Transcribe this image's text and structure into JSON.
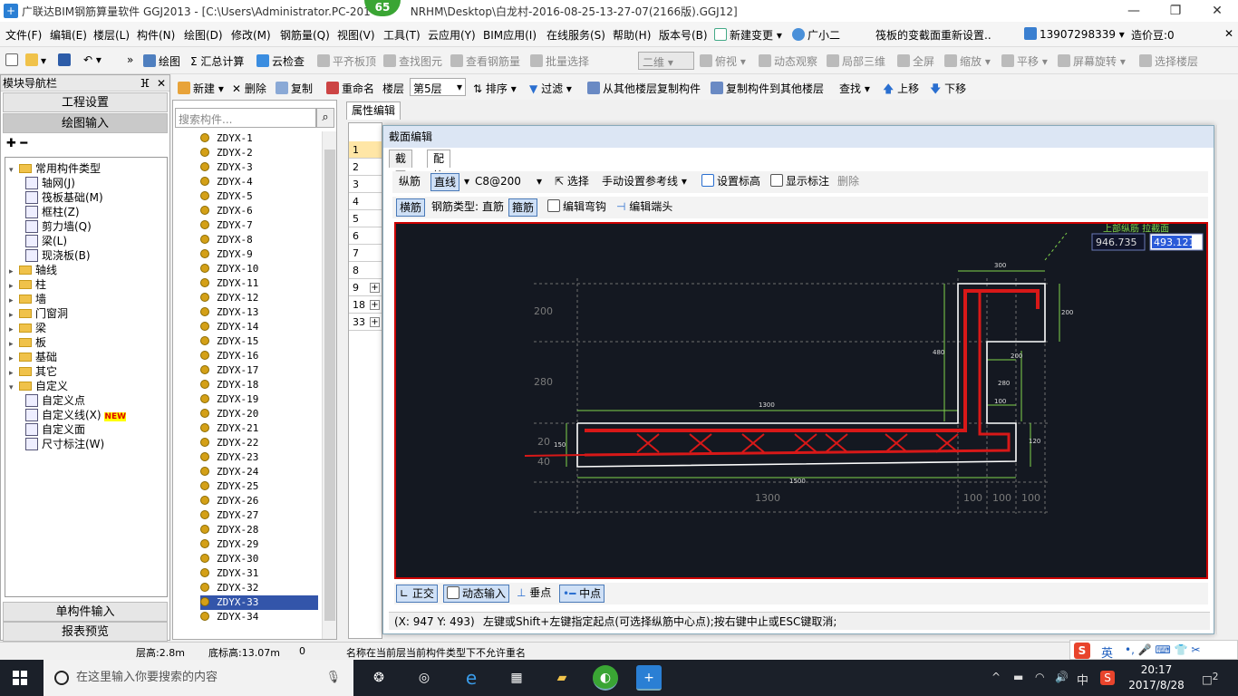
{
  "window": {
    "title": "广联达BIM钢筋算量软件 GGJ2013 - [C:\\Users\\Administrator.PC-201",
    "title_tail": "NRHM\\Desktop\\白龙村-2016-08-25-13-27-07(2166版).GGJ12]",
    "badge": "65",
    "min": "—",
    "max": "❐",
    "close": "✕"
  },
  "menu": {
    "items": [
      "文件(F)",
      "编辑(E)",
      "楼层(L)",
      "构件(N)",
      "绘图(D)",
      "修改(M)",
      "钢筋量(Q)",
      "视图(V)",
      "工具(T)",
      "云应用(Y)",
      "BIM应用(I)",
      "在线服务(S)",
      "帮助(H)",
      "版本号(B)",
      "新建变更 ▾",
      "广小二"
    ],
    "notice": "筏板的变截面重新设置..",
    "phone": "13907298339 ▾",
    "price": "造价豆:0",
    "close": "✕"
  },
  "toolbar1": {
    "items": [
      "绘图",
      "Σ 汇总计算",
      "云检查",
      "平齐板顶",
      "查找图元",
      "查看钢筋量",
      "批量选择",
      "二维",
      "俯视 ▾",
      "动态观察",
      "局部三维",
      "全屏",
      "缩放 ▾",
      "平移 ▾",
      "屏幕旋转 ▾",
      "选择楼层"
    ]
  },
  "toolbar2": {
    "items": [
      "新建 ▾",
      "删除",
      "复制",
      "重命名",
      "楼层",
      "第5层",
      "排序 ▾",
      "过滤 ▾",
      "从其他楼层复制构件",
      "复制构件到其他楼层",
      "查找 ▾",
      "上移",
      "下移"
    ]
  },
  "left_panel": {
    "title": "模块导航栏",
    "pin": "ⴼ",
    "close": "✕",
    "btn_project": "工程设置",
    "btn_draw": "绘图输入",
    "btn_single": "单构件输入",
    "btn_report": "报表预览",
    "tree": [
      {
        "label": "常用构件类型",
        "level": 0,
        "type": "folder",
        "exp": "▾"
      },
      {
        "label": "轴网(J)",
        "level": 1,
        "type": "leaf"
      },
      {
        "label": "筏板基础(M)",
        "level": 1,
        "type": "leaf"
      },
      {
        "label": "框柱(Z)",
        "level": 1,
        "type": "leaf"
      },
      {
        "label": "剪力墙(Q)",
        "level": 1,
        "type": "leaf"
      },
      {
        "label": "梁(L)",
        "level": 1,
        "type": "leaf"
      },
      {
        "label": "现浇板(B)",
        "level": 1,
        "type": "leaf"
      },
      {
        "label": "轴线",
        "level": 0,
        "type": "folder",
        "exp": "▸"
      },
      {
        "label": "柱",
        "level": 0,
        "type": "folder",
        "exp": "▸"
      },
      {
        "label": "墙",
        "level": 0,
        "type": "folder",
        "exp": "▸"
      },
      {
        "label": "门窗洞",
        "level": 0,
        "type": "folder",
        "exp": "▸"
      },
      {
        "label": "梁",
        "level": 0,
        "type": "folder",
        "exp": "▸"
      },
      {
        "label": "板",
        "level": 0,
        "type": "folder",
        "exp": "▸"
      },
      {
        "label": "基础",
        "level": 0,
        "type": "folder",
        "exp": "▸"
      },
      {
        "label": "其它",
        "level": 0,
        "type": "folder",
        "exp": "▸"
      },
      {
        "label": "自定义",
        "level": 0,
        "type": "folder",
        "exp": "▾"
      },
      {
        "label": "自定义点",
        "level": 1,
        "type": "leaf"
      },
      {
        "label": "自定义线(X)",
        "level": 1,
        "type": "leaf",
        "new": "NEW"
      },
      {
        "label": "自定义面",
        "level": 1,
        "type": "leaf"
      },
      {
        "label": "尺寸标注(W)",
        "level": 1,
        "type": "leaf"
      }
    ]
  },
  "component_list": {
    "search_placeholder": "搜索构件...",
    "search_icon": "⌕",
    "items": [
      "ZDYX-1",
      "ZDYX-2",
      "ZDYX-3",
      "ZDYX-4",
      "ZDYX-5",
      "ZDYX-6",
      "ZDYX-7",
      "ZDYX-8",
      "ZDYX-9",
      "ZDYX-10",
      "ZDYX-11",
      "ZDYX-12",
      "ZDYX-13",
      "ZDYX-14",
      "ZDYX-15",
      "ZDYX-16",
      "ZDYX-17",
      "ZDYX-18",
      "ZDYX-19",
      "ZDYX-20",
      "ZDYX-21",
      "ZDYX-22",
      "ZDYX-23",
      "ZDYX-24",
      "ZDYX-25",
      "ZDYX-26",
      "ZDYX-27",
      "ZDYX-28",
      "ZDYX-29",
      "ZDYX-30",
      "ZDYX-31",
      "ZDYX-32",
      "ZDYX-33",
      "ZDYX-34"
    ],
    "selected": "ZDYX-33"
  },
  "property": {
    "tab": "属性编辑",
    "rows": [
      "1",
      "2",
      "3",
      "4",
      "5",
      "6",
      "7",
      "8",
      "9",
      "18",
      "33"
    ],
    "expandable_plus": "+"
  },
  "dialog": {
    "title": "截面编辑",
    "tabs": [
      "截面",
      "配筋"
    ],
    "active_tab": "配筋",
    "toolbar1": {
      "longitudinal": "纵筋",
      "line": "直线",
      "spec": "C8@200",
      "select": "选择",
      "manual": "手动设置参考线",
      "set_elev": "设置标高",
      "show_dim": "显示标注",
      "delete": "删除"
    },
    "toolbar2": {
      "transverse": "横筋",
      "rebar_type_label": "钢筋类型:",
      "straight": "直筋",
      "stirrup": "箍筋",
      "edit_hook": "编辑弯钩",
      "edit_end": "编辑端头"
    },
    "coord_x": "946.735",
    "coord_y": "493.121",
    "label_top": "上部纵筋 拉截面",
    "dims": {
      "d300": "300",
      "d200r": "200",
      "d480": "480",
      "d200b": "200",
      "d280": "280",
      "d100a": "100",
      "d1300": "1300",
      "d150": "150",
      "d120": "120",
      "d1500": "1500",
      "g200": "200",
      "g280": "280",
      "g20": "20",
      "g40": "40",
      "b1300": "1300",
      "b100a": "100",
      "b100b": "100",
      "b100c": "100"
    },
    "toolbar3": {
      "ortho": "正交",
      "dynamic": "动态输入",
      "perp": "垂点",
      "mid": "中点"
    },
    "status_coord": "(X: 947 Y: 493)",
    "status_msg": "左键或Shift+左键指定起点(可选择纵筋中心点);按右键中止或ESC键取消;"
  },
  "statusbar": {
    "floor_h": "层高:2.8m",
    "base_h": "底标高:13.07m",
    "zero": "0",
    "msg": "名称在当前层当前构件类型下不允许重名"
  },
  "ime": {
    "lang": "英",
    "items": "•, 🎤 ⌨ 👕 ✂"
  },
  "taskbar": {
    "search_placeholder": "在这里输入你要搜索的内容",
    "time": "20:17",
    "date": "2017/8/28",
    "ime": "中",
    "notif": "2"
  },
  "colors": {
    "canvas_bg": "#141821",
    "rebar": "#d81818",
    "dim": "#7fd34a",
    "outline": "#ffffff",
    "grid": "#7a7a7a",
    "accent_red": "#c00000"
  }
}
